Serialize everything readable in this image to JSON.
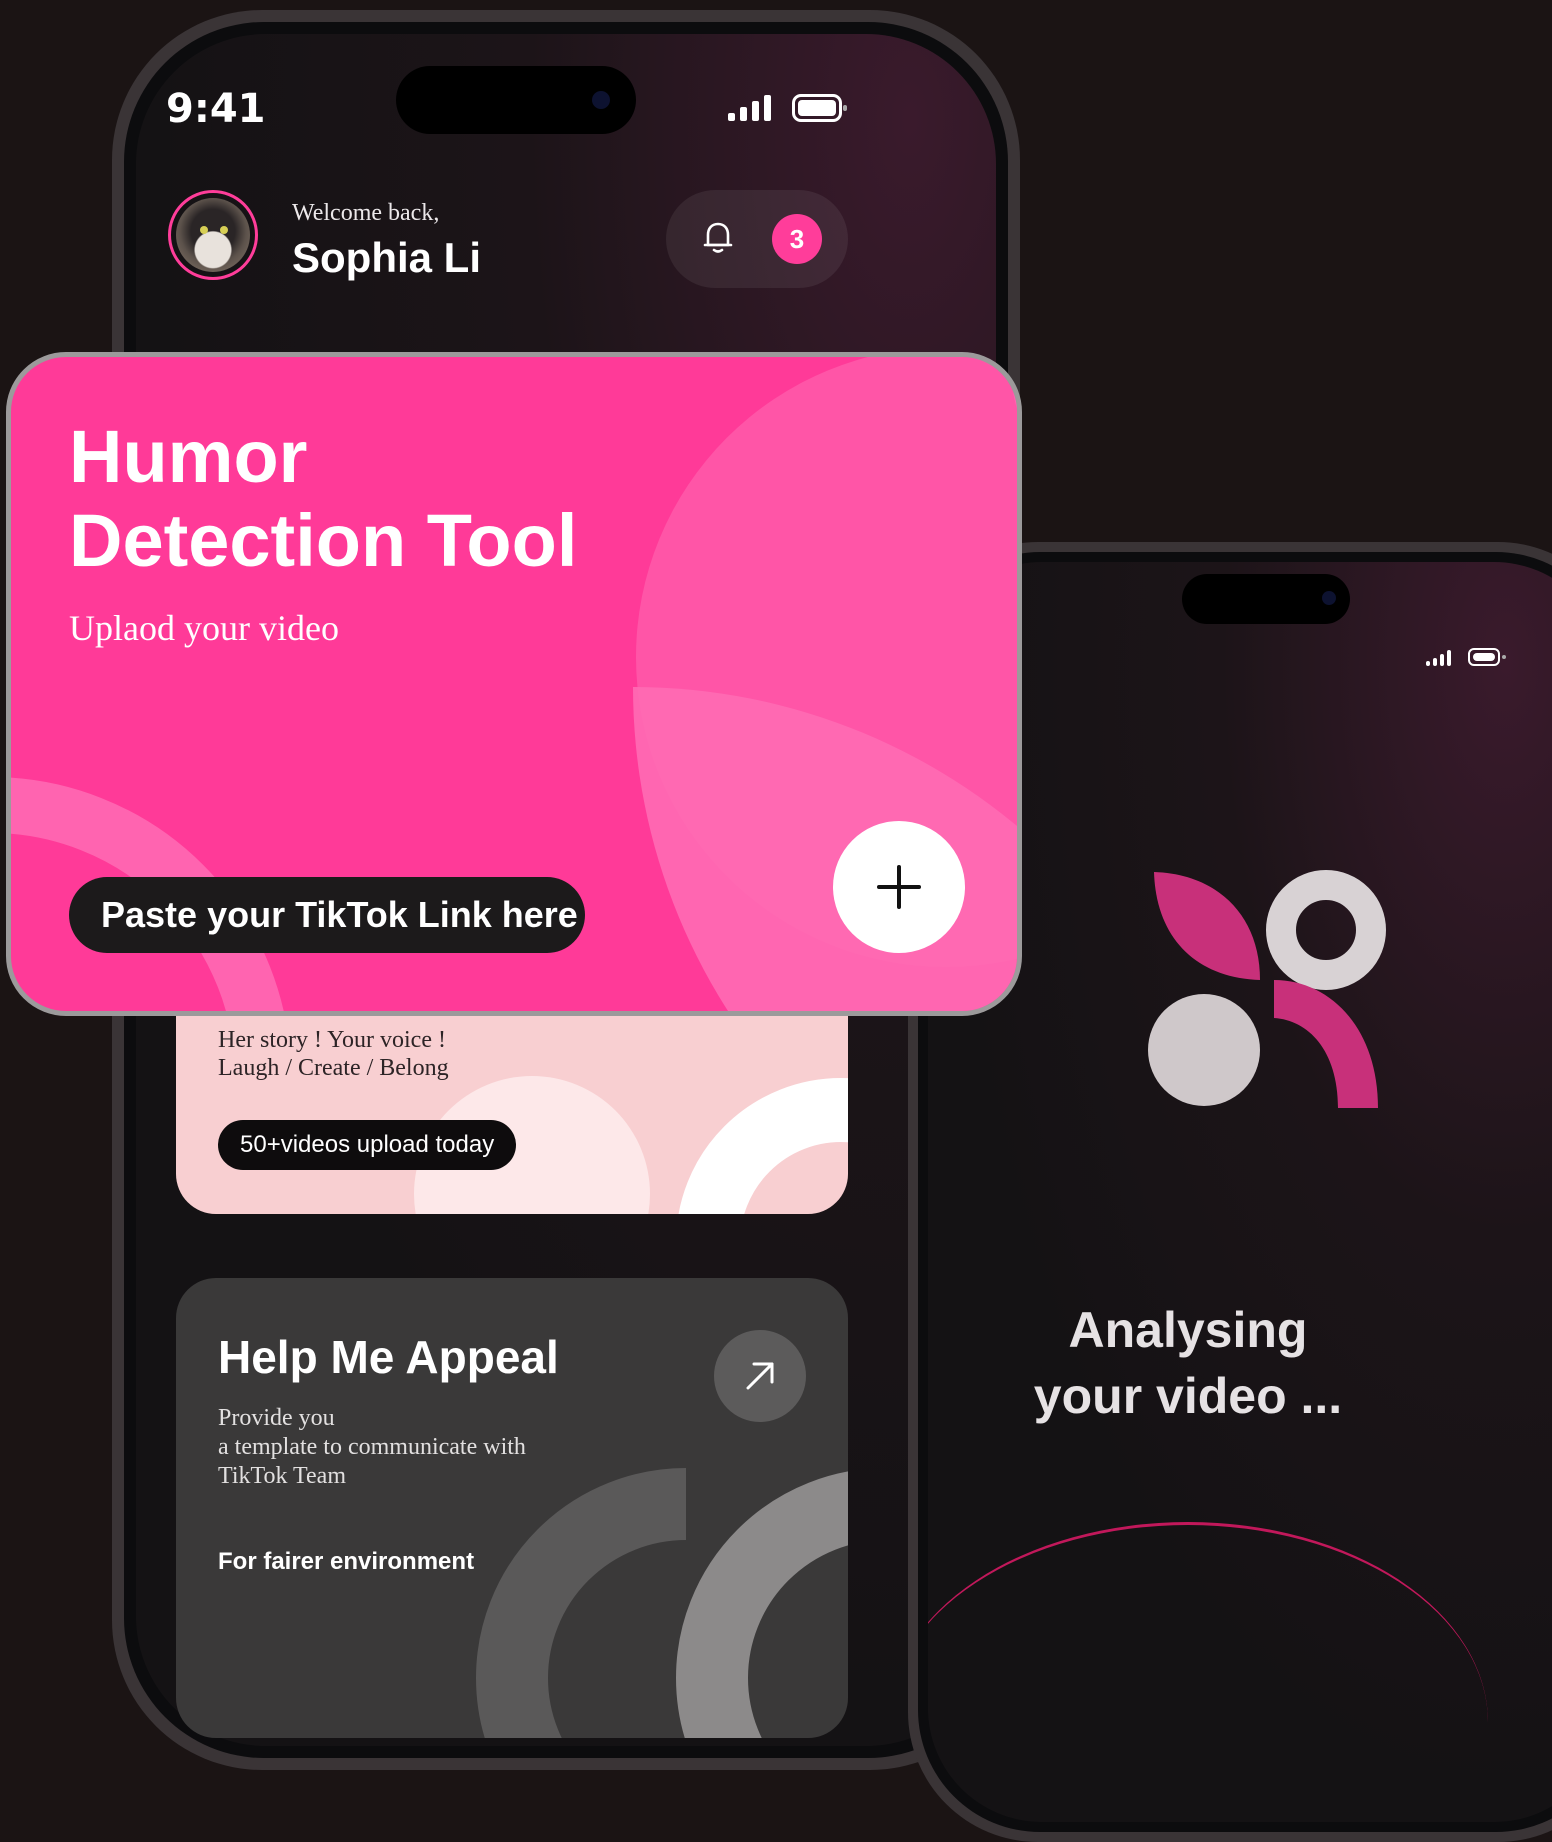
{
  "status": {
    "time": "9:41"
  },
  "user": {
    "welcome": "Welcome back,",
    "name": "Sophia Li",
    "notification_count": "3"
  },
  "hero": {
    "title_line1": "Humor",
    "title_line2": "Detection Tool",
    "subtitle": "Uplaod your video",
    "paste_placeholder": "Paste your TikTok Link here"
  },
  "promo": {
    "line1": "Her story ! Your voice !",
    "line2": "Laugh / Create / Belong",
    "uploads": "50+videos upload today"
  },
  "appeal": {
    "title": "Help Me Appeal",
    "desc_line1": "Provide you",
    "desc_line2": "a template to communicate with",
    "desc_line3": "TikTok Team",
    "footer": "For fairer environment"
  },
  "analysis": {
    "line1": "Analysing",
    "line2": "your video ..."
  },
  "colors": {
    "accent": "#ff3a98",
    "light_pink": "#f8cfd1",
    "dark": "#141214"
  },
  "icons": [
    "bell-icon",
    "plus-icon",
    "arrow-up-right-icon",
    "signal-icon",
    "battery-icon",
    "app-logo-icon"
  ]
}
